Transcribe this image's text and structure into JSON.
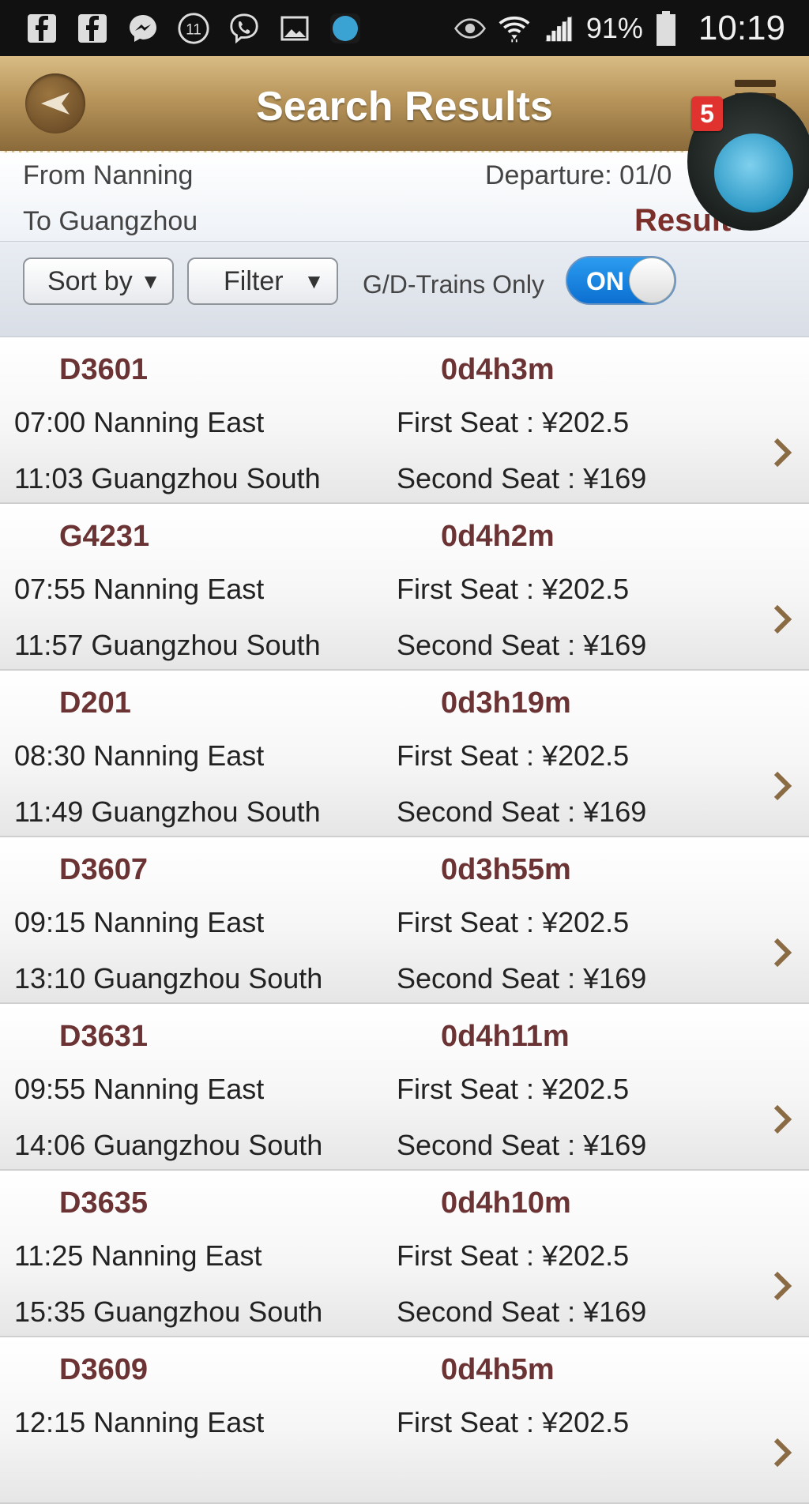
{
  "status_bar": {
    "battery": "91%",
    "time": "10:19",
    "notification_count": "11",
    "icons": [
      "facebook-icon",
      "facebook-icon",
      "messenger-icon",
      "notification-count-icon",
      "viber-icon",
      "gallery-icon",
      "blue-dot-icon",
      "eye-icon",
      "wifi-icon",
      "signal-icon",
      "battery-icon"
    ]
  },
  "header": {
    "title": "Search Results"
  },
  "info": {
    "from": "From Nanning",
    "to": "To Guangzhou",
    "departure": "Departure: 01/0",
    "results": "Result"
  },
  "controls": {
    "sort_label": "Sort by",
    "filter_label": "Filter",
    "gd_label": "G/D-Trains Only",
    "toggle_label": "ON",
    "toggle_on": true
  },
  "bubble": {
    "badge": "5"
  },
  "trains": [
    {
      "code": "D3601",
      "duration": "0d4h3m",
      "departure": "07:00 Nanning East",
      "arrival": "11:03 Guangzhou South",
      "first_seat": "First Seat : ¥202.5",
      "second_seat": "Second Seat : ¥169"
    },
    {
      "code": "G4231",
      "duration": "0d4h2m",
      "departure": "07:55 Nanning East",
      "arrival": "11:57 Guangzhou South",
      "first_seat": "First Seat : ¥202.5",
      "second_seat": "Second Seat : ¥169"
    },
    {
      "code": "D201",
      "duration": "0d3h19m",
      "departure": "08:30 Nanning East",
      "arrival": "11:49 Guangzhou South",
      "first_seat": "First Seat : ¥202.5",
      "second_seat": "Second Seat : ¥169"
    },
    {
      "code": "D3607",
      "duration": "0d3h55m",
      "departure": "09:15 Nanning East",
      "arrival": "13:10 Guangzhou South",
      "first_seat": "First Seat : ¥202.5",
      "second_seat": "Second Seat : ¥169"
    },
    {
      "code": "D3631",
      "duration": "0d4h11m",
      "departure": "09:55 Nanning East",
      "arrival": "14:06 Guangzhou South",
      "first_seat": "First Seat : ¥202.5",
      "second_seat": "Second Seat : ¥169"
    },
    {
      "code": "D3635",
      "duration": "0d4h10m",
      "departure": "11:25 Nanning East",
      "arrival": "15:35 Guangzhou South",
      "first_seat": "First Seat : ¥202.5",
      "second_seat": "Second Seat : ¥169"
    },
    {
      "code": "D3609",
      "duration": "0d4h5m",
      "departure": "12:15 Nanning East",
      "arrival": "",
      "first_seat": "First Seat : ¥202.5",
      "second_seat": ""
    }
  ],
  "colors": {
    "header_gold": "#b8955b",
    "train_code": "#6b3333",
    "toggle_blue": "#1a84e0",
    "badge_red": "#e0322e"
  }
}
